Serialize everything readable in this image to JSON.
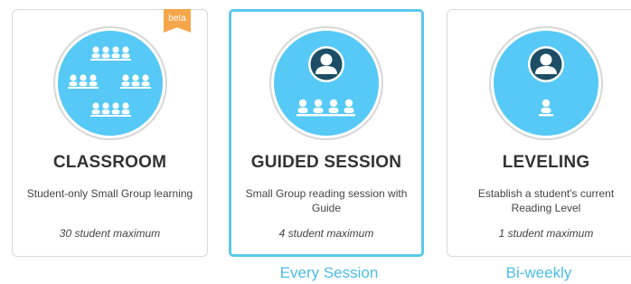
{
  "cards": [
    {
      "title": "CLASSROOM",
      "description": "Student-only Small Group learning",
      "maximum": "30 student maximum",
      "badge": "beta",
      "icon": "classroom-groups-icon",
      "selected": false
    },
    {
      "title": "GUIDED SESSION",
      "description": "Small Group reading session with Guide",
      "maximum": "4 student maximum",
      "icon": "guide-with-group-icon",
      "selected": true
    },
    {
      "title": "LEVELING",
      "description": "Establish a student's current Reading Level",
      "maximum": "1 student maximum",
      "icon": "guide-with-student-icon",
      "selected": false
    }
  ],
  "frequency": {
    "guided": "Every Session",
    "leveling": "Bi-weekly"
  },
  "colors": {
    "accent": "#56c9f6",
    "selected_border": "#5bc8ec",
    "badge": "#f5a64a",
    "guide_avatar": "#1d4e66"
  }
}
